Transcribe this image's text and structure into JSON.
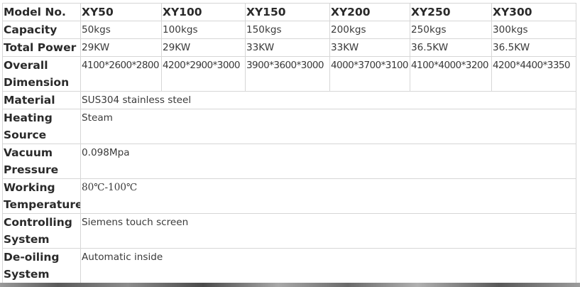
{
  "table": {
    "header": {
      "label": "Model No.",
      "models": [
        "XY50",
        "XY100",
        "XY150",
        "XY200",
        "XY250",
        "XY300"
      ]
    },
    "capacity": {
      "label": "Capacity",
      "values": [
        "50kgs",
        "100kgs",
        "150kgs",
        "200kgs",
        "250kgs",
        "300kgs"
      ]
    },
    "power": {
      "label": "Total Power",
      "values": [
        "29KW",
        "29KW",
        "33KW",
        "33KW",
        "36.5KW",
        "36.5KW"
      ]
    },
    "dimension": {
      "label": "Overall Dimension",
      "values": [
        "4100*2600*2800",
        "4200*2900*3000",
        "3900*3600*3000",
        "4000*3700*3100",
        "4100*4000*3200",
        "4200*4400*3350"
      ]
    },
    "material": {
      "label": "Material",
      "value": "SUS304 stainless steel"
    },
    "heating": {
      "label": "Heating Source",
      "value": "Steam"
    },
    "vacuum": {
      "label": "Vacuum Pressure",
      "value": "0.098Mpa"
    },
    "temperature": {
      "label": "Working Temperature",
      "value": "80℃-100℃"
    },
    "control": {
      "label": "Controlling System",
      "value": "Siemens touch screen"
    },
    "deoiling": {
      "label": "De-oiling System",
      "value": "Automatic inside"
    }
  }
}
